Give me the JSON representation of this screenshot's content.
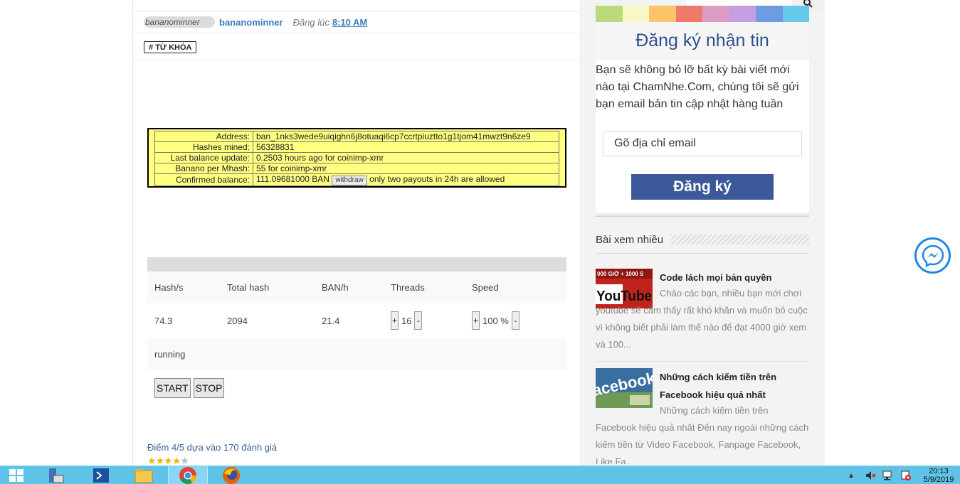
{
  "post": {
    "avatar_alt": "bananominner",
    "author": "bananominner",
    "posted_label": "Đăng lúc",
    "posted_time": "8:10 AM",
    "tag_label": "TỪ KHÓA"
  },
  "banano_info": {
    "rows": [
      {
        "label": "Address:",
        "value": "ban_1nks3wede9uiqighn6j8otuaqi6cp7ccrtpiuztto1g1tjom41mwzt9n6ze9"
      },
      {
        "label": "Hashes mined:",
        "value": "56328831"
      },
      {
        "label": "Last balance update:",
        "value": "0.2503 hours ago for coinimp-xmr"
      },
      {
        "label": "Banano per Mhash:",
        "value": "55 for coinimp-xmr"
      },
      {
        "label": "Confirmed balance:",
        "value": "111.09681000 BAN"
      }
    ],
    "withdraw_label": "withdraw",
    "withdraw_note": "only two payouts in 24h are allowed"
  },
  "miner": {
    "headers": [
      "Hash/s",
      "Total hash",
      "BAN/h",
      "Threads",
      "Speed"
    ],
    "hash_rate": "74.3",
    "total_hash": "2094",
    "ban_per_hour": "21.4",
    "threads": "16",
    "speed": "100 %",
    "plus": "+",
    "minus": "-",
    "status": "running",
    "start_label": "START",
    "stop_label": "STOP"
  },
  "rating": {
    "text": "Điểm 4/5 dựa vào 170 đánh giá",
    "score": 4,
    "max": 5
  },
  "sidebar": {
    "search_placeholder": "Tìm kiếm...",
    "strip_colors": [
      "#bada7c",
      "#f6f9c6",
      "#fdc56b",
      "#ef7a6c",
      "#dc9dc4",
      "#c49ee2",
      "#6e9be2",
      "#67c9e9"
    ],
    "newsletter": {
      "title": "Đăng ký nhận tin",
      "text": "Bạn sẽ không bỏ lỡ bất kỳ bài viết mới nào tại ChamNhe.Com, chúng tôi sẽ gửi bạn email bản tin cập nhật hàng tuần",
      "email_placeholder": "Gõ địa chỉ email",
      "subscribe_label": "Đăng ký"
    },
    "popular": {
      "title": "Bài xem nhiều",
      "items": [
        {
          "thumb_caption": "000 GIỜ + 1000 S",
          "thumb_logo": "YouTube",
          "title": "Code lách mọi bản quyền",
          "excerpt": "Chào các bạn, nhiều bạn mới chơi youtube sẽ cảm thấy rất khó khăn và muốn bỏ cuộc vì không biết phải làm thế nào để đạt 4000 giờ xem và 100..."
        },
        {
          "thumb_logo": "acebook",
          "title": "Những cách kiếm tiền trên Facebook hiệu quả nhất",
          "excerpt": "Những cách kiếm tiền trên Facebook hiệu quả nhất Đến nay ngoài những cách kiếm tiền từ Video Facebook, Fanpage Facebook, Like Fa..."
        }
      ]
    }
  },
  "taskbar": {
    "time": "20:13",
    "date": "5/9/2019",
    "accent": "#5fc3e8"
  }
}
